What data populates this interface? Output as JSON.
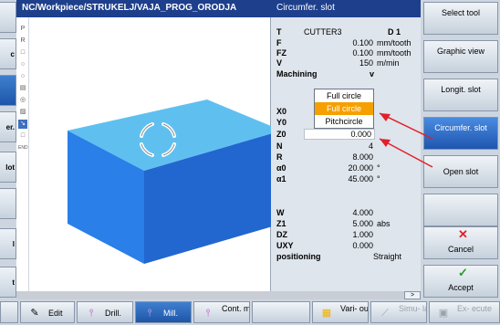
{
  "header": {
    "path": "NC/Workpiece/STRUKELJ/VAJA_PROG_ORODJA",
    "panel_title": "Circumfer. slot"
  },
  "left_softkeys": [
    {
      "label": "",
      "active": false
    },
    {
      "label": "c",
      "active": false
    },
    {
      "label": "",
      "active": true
    },
    {
      "label": "er.",
      "active": false
    },
    {
      "label": "lot",
      "active": false
    },
    {
      "label": "",
      "active": false
    },
    {
      "label": "l",
      "active": false
    },
    {
      "label": "t",
      "active": false
    }
  ],
  "tool_icons": [
    "P",
    "R",
    "□",
    "○",
    "○",
    "▤",
    "◎",
    "▨",
    "↘",
    "□",
    "END"
  ],
  "params": {
    "T": {
      "label": "T",
      "value": "CUTTER3",
      "extra": "D 1"
    },
    "F": {
      "label": "F",
      "value": "0.100",
      "unit": "mm/tooth"
    },
    "FZ": {
      "label": "FZ",
      "value": "0.100",
      "unit": "mm/tooth"
    },
    "V": {
      "label": "V",
      "value": "150",
      "unit": "m/min"
    },
    "machining": {
      "label": "Machining",
      "value": "v"
    },
    "X0": {
      "label": "X0",
      "value": ""
    },
    "Y0": {
      "label": "Y0",
      "value": ""
    },
    "Z0": {
      "label": "Z0",
      "value": "0.000"
    },
    "N": {
      "label": "N",
      "value": "4"
    },
    "R": {
      "label": "R",
      "value": "8.000"
    },
    "a0": {
      "label": "α0",
      "value": "20.000",
      "unit": "°"
    },
    "a1": {
      "label": "α1",
      "value": "45.000",
      "unit": "°"
    },
    "W": {
      "label": "W",
      "value": "4.000"
    },
    "Z1": {
      "label": "Z1",
      "value": "5.000",
      "unit": "abs"
    },
    "DZ": {
      "label": "DZ",
      "value": "1.000"
    },
    "UXY": {
      "label": "UXY",
      "value": "0.000"
    },
    "positioning": {
      "label": "positioning",
      "value": "Straight"
    }
  },
  "dropdown": {
    "options": [
      "Full circle",
      "Full circle",
      "Pitchcircle"
    ],
    "selected_index": 1
  },
  "right_softkeys": [
    {
      "label": "Select tool",
      "active": false
    },
    {
      "label": "Graphic view",
      "active": false
    },
    {
      "label": "Longit. slot",
      "active": false
    },
    {
      "label": "Circumfer. slot",
      "active": true
    },
    {
      "label": "Open slot",
      "active": false
    },
    {
      "label": "",
      "active": false
    },
    {
      "label": "Cancel",
      "active": false
    },
    {
      "label": "Accept",
      "active": false
    }
  ],
  "bottom_softkeys": {
    "edit": "Edit",
    "drill": "Drill.",
    "mill": "Mill.",
    "cont_mill": "Cont. mill.",
    "various": "Vari- ous",
    "simulation": "Simu- lation",
    "execute": "Ex- ecute"
  },
  "colors": {
    "header_bg": "#1e3f8c",
    "active_softkey": "#1e56a8",
    "workpiece_top": "#5fc0f0",
    "workpiece_front": "#2a7fe8",
    "dropdown_selected": "#f5a000",
    "annotation_arrow": "#e0202a"
  }
}
